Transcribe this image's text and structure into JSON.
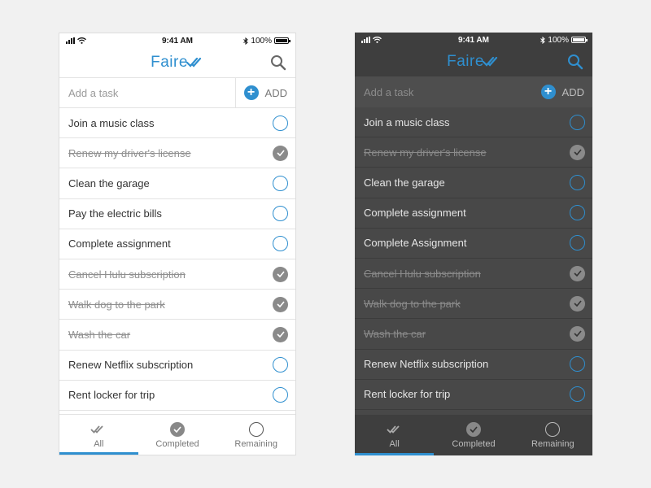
{
  "colors": {
    "accent": "#2f8fcf",
    "completed_gray": "#8a8a8a"
  },
  "phones": {
    "light": {
      "status": {
        "time": "9:41 AM",
        "battery": "100%",
        "battery_level": 1.0
      },
      "header": {
        "logo": "Faire"
      },
      "add_task": {
        "placeholder": "Add a task",
        "button": "ADD"
      },
      "tasks": [
        {
          "label": "Join a music class",
          "completed": false
        },
        {
          "label": "Renew my driver's license",
          "completed": true
        },
        {
          "label": "Clean the garage",
          "completed": false
        },
        {
          "label": "Pay the electric bills",
          "completed": false
        },
        {
          "label": "Complete assignment",
          "completed": false
        },
        {
          "label": "Cancel Hulu subscription",
          "completed": true
        },
        {
          "label": "Walk dog to the park",
          "completed": true
        },
        {
          "label": "Wash the car",
          "completed": true
        },
        {
          "label": "Renew Netflix subscription",
          "completed": false
        },
        {
          "label": "Rent locker for trip",
          "completed": false
        }
      ],
      "tabs": {
        "all": "All",
        "completed": "Completed",
        "remaining": "Remaining",
        "active": "all"
      }
    },
    "dark": {
      "status": {
        "time": "9:41 AM",
        "battery": "100%",
        "battery_level": 1.0
      },
      "header": {
        "logo": "Faire"
      },
      "add_task": {
        "placeholder": "Add a task",
        "button": "ADD"
      },
      "tasks": [
        {
          "label": "Join a music class",
          "completed": false
        },
        {
          "label": "Renew my driver's license",
          "completed": true
        },
        {
          "label": "Clean the garage",
          "completed": false
        },
        {
          "label": "Complete assignment",
          "completed": false
        },
        {
          "label": "Complete Assignment",
          "completed": false
        },
        {
          "label": "Cancel Hulu subscription",
          "completed": true
        },
        {
          "label": "Walk dog to the park",
          "completed": true
        },
        {
          "label": "Wash the car",
          "completed": true
        },
        {
          "label": "Renew Netflix subscription",
          "completed": false
        },
        {
          "label": "Rent locker for trip",
          "completed": false
        }
      ],
      "tabs": {
        "all": "All",
        "completed": "Completed",
        "remaining": "Remaining",
        "active": "all"
      }
    }
  }
}
